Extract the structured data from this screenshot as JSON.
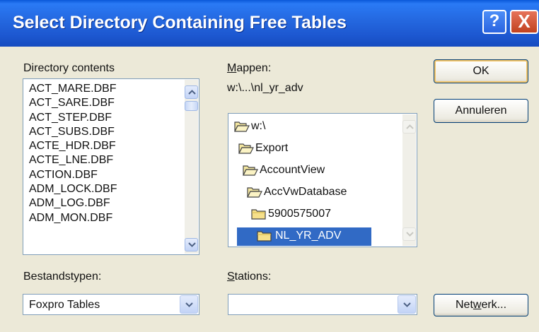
{
  "window": {
    "title": "Select Directory Containing Free Tables",
    "help_glyph": "?",
    "close_glyph": "X"
  },
  "directory_contents": {
    "label": "Directory contents",
    "files": [
      "ACT_MARE.DBF",
      "ACT_SARE.DBF",
      "ACT_STEP.DBF",
      "ACT_SUBS.DBF",
      "ACTE_HDR.DBF",
      "ACTE_LNE.DBF",
      "ACTION.DBF",
      "ADM_LOCK.DBF",
      "ADM_LOG.DBF",
      "ADM_MON.DBF"
    ]
  },
  "folders": {
    "label": "Mappen:",
    "current_path": "w:\\...\\nl_yr_adv",
    "tree": [
      "w:\\",
      "Export",
      "AccountView",
      "AccVwDatabase",
      "5900575007",
      "NL_YR_ADV"
    ],
    "selected": "NL_YR_ADV"
  },
  "file_types": {
    "label": "Bestandstypen:",
    "value": "Foxpro Tables"
  },
  "drives": {
    "label": "Stations:",
    "value": ""
  },
  "buttons": {
    "ok": "OK",
    "cancel": "Annuleren",
    "network": "Netwerk..."
  },
  "icons": [
    "help-icon",
    "close-icon",
    "folder-open-icon",
    "folder-closed-icon",
    "chevron-up-icon",
    "chevron-down-icon"
  ]
}
